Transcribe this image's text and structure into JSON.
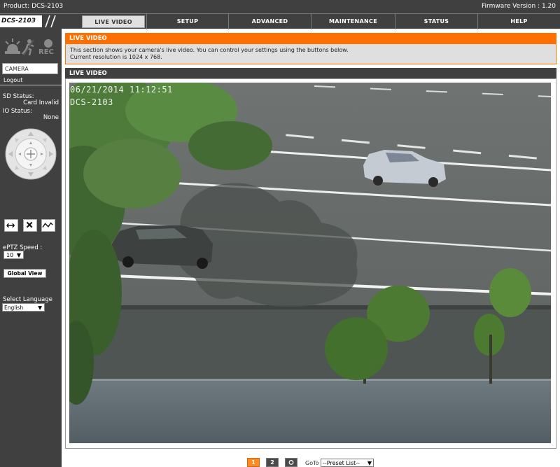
{
  "header": {
    "product": "Product: DCS-2103",
    "firmware": "Firmware Version : 1.20"
  },
  "logo": "DCS-2103",
  "nav": {
    "tabs": [
      {
        "label": "LIVE VIDEO",
        "active": true
      },
      {
        "label": "SETUP",
        "active": false
      },
      {
        "label": "ADVANCED",
        "active": false
      },
      {
        "label": "MAINTENANCE",
        "active": false
      },
      {
        "label": "STATUS",
        "active": false
      },
      {
        "label": "HELP",
        "active": false
      }
    ]
  },
  "sidebar": {
    "icons": [
      "alarm-light-icon",
      "motion-icon",
      "rec-icon"
    ],
    "rec_label": "REC",
    "camera_label": "CAMERA",
    "logout": "Logout",
    "sd_status_label": "SD Status:",
    "sd_status_value": "Card Invalid",
    "io_status_label": "IO Status:",
    "io_status_value": "None",
    "eptz_speed_label": "ePTZ Speed :",
    "eptz_speed_value": "10",
    "global_view": "Global View",
    "select_language_label": "Select Language",
    "language_value": "English"
  },
  "main": {
    "title": "LIVE VIDEO",
    "description_line1": "This section shows your camera's live video. You can control your settings using the buttons below.",
    "description_line2": "Current resolution is 1024 x 768.",
    "video_title": "LIVE VIDEO",
    "video": {
      "timestamp": "06/21/2014 11:12:51",
      "camera_name": "DCS-2103"
    }
  },
  "controls": {
    "stream1": "1",
    "stream2": "2",
    "snapshot_icon": "camera-icon",
    "goto_label": "GoTo",
    "preset_value": "--Preset List--"
  },
  "colors": {
    "accent": "#ff6f00",
    "dark": "#404040",
    "active_tab": "#e0e0e0"
  }
}
